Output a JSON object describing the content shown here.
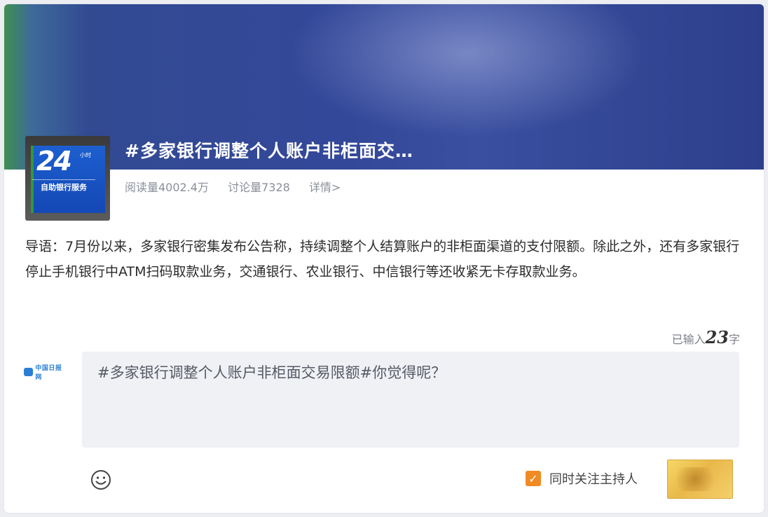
{
  "topic": {
    "title": "#多家银行调整个人账户非柜面交…",
    "reads": "阅读量4002.4万",
    "discussions": "讨论量7328",
    "details_link": "详情>",
    "cover_number": "24",
    "cover_hours": "小时",
    "cover_caption": "自助银行服务"
  },
  "intro_text": "导语：7月份以来，多家银行密集发布公告称，持续调整个人结算账户的非柜面渠道的支付限额。除此之外，还有多家银行停止手机银行中ATM扫码取款业务，交通银行、农业银行、中信银行等还收紧无卡存取款业务。",
  "composer": {
    "counter_prefix": "已输入",
    "counter_value": "23",
    "counter_suffix": "字",
    "input_text": "#多家银行调整个人账户非柜面交易限额#你觉得呢？",
    "avatar_text": "中国日报网",
    "emoji_icon": "smiley-icon",
    "follow_label": "同时关注主持人",
    "follow_checked": true
  },
  "colors": {
    "banner_blue": "#34489a",
    "checkbox_orange": "#f08a24",
    "send_gold": "#e9b84a"
  }
}
